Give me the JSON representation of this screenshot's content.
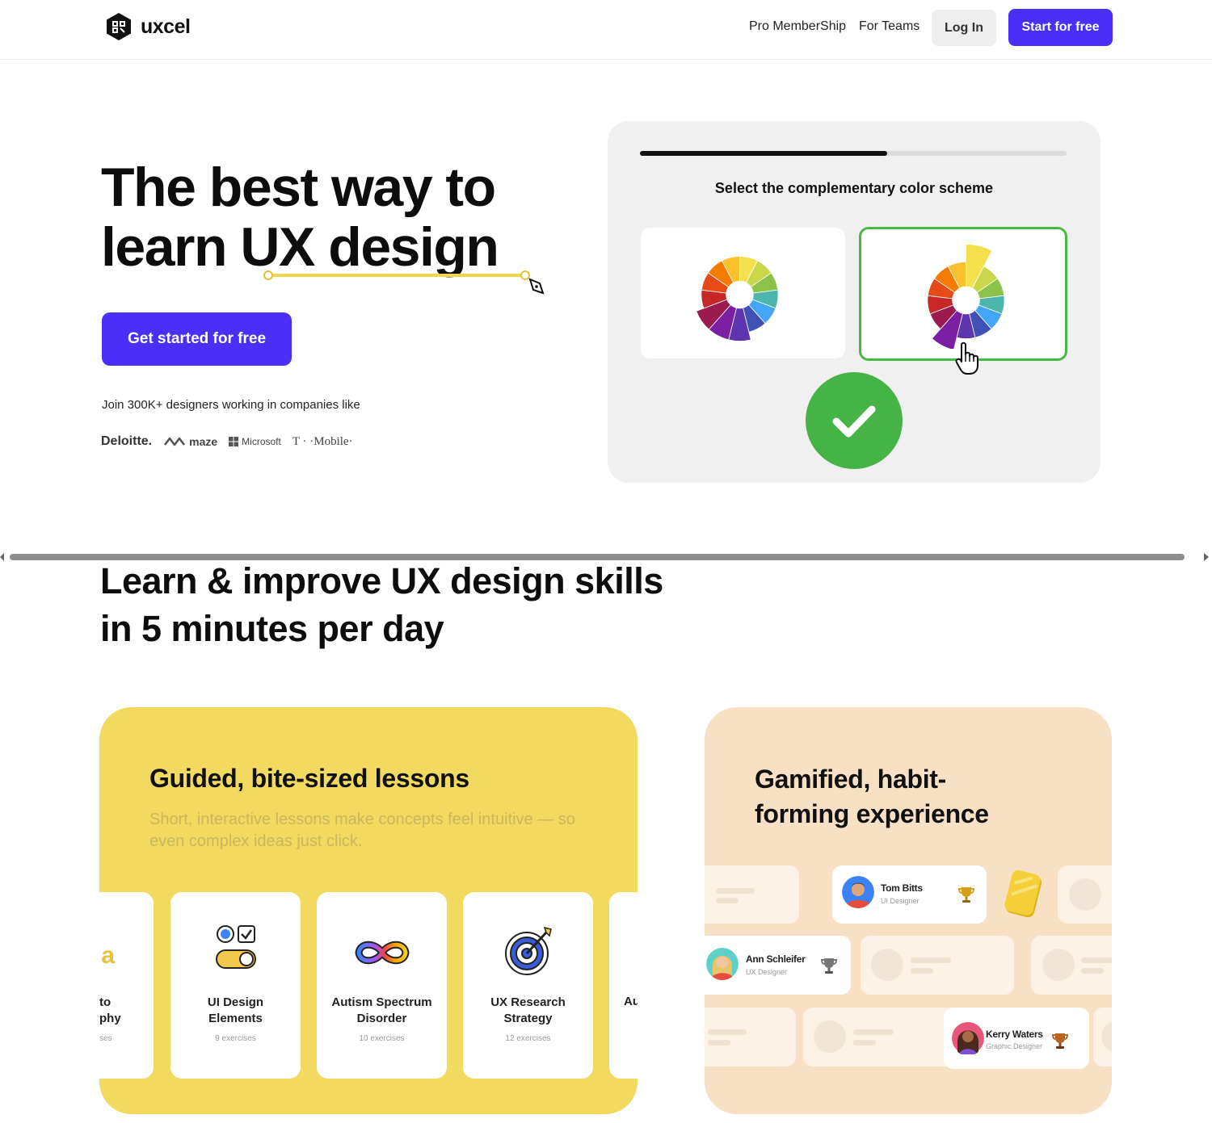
{
  "nav": {
    "brand": "uxcel",
    "links": [
      "Pro MemberShip",
      "For Teams"
    ],
    "login": "Log In",
    "cta": "Start for free"
  },
  "hero": {
    "title_line1": "The best way to",
    "title_line2": "learn UX design",
    "cta": "Get started for free",
    "join": "Join 300K+ designers working in companies like",
    "companies": [
      "Deloitte.",
      "maze",
      "Microsoft",
      "T · ·Mobile·"
    ]
  },
  "quiz": {
    "progress": 0.58,
    "question": "Select the complementary color scheme",
    "selected_option": 2
  },
  "section": {
    "title_line1": "Learn & improve UX design skills",
    "title_line2": "in 5 minutes per day"
  },
  "guided": {
    "title": "Guided, bite-sized lessons",
    "subtitle": "Short, interactive lessons make concepts feel intuitive — so even complex ideas just click.",
    "lessons": [
      {
        "name_line1": "to",
        "name_line2": "phy",
        "count": "ses",
        "partial": true
      },
      {
        "name_line1": "UI Design",
        "name_line2": "Elements",
        "count": "9 exercises",
        "icon": "toggle-checkbox-icon"
      },
      {
        "name_line1": "Autism Spectrum",
        "name_line2": "Disorder",
        "count": "10 exercises",
        "icon": "infinity-icon"
      },
      {
        "name_line1": "UX Research",
        "name_line2": "Strategy",
        "count": "12 exercises",
        "icon": "target-icon"
      },
      {
        "name_line1": "Au",
        "name_line2": "",
        "count": "",
        "partial": true
      }
    ]
  },
  "gamified": {
    "title_line1": "Gamified, habit-",
    "title_line2": "forming experience",
    "people": [
      {
        "name": "Tom Bitts",
        "role": "UI Designer",
        "trophy": "gold"
      },
      {
        "name": "Ann Schleifer",
        "role": "UX Designer",
        "trophy": "silver"
      },
      {
        "name": "Kerry Waters",
        "role": "Graphic Designer",
        "trophy": "bronze"
      }
    ]
  },
  "colors": {
    "brand": "#4b2ff6",
    "success": "#46b346",
    "yellow_card": "#f2d960",
    "peach_card": "#f7e0c4"
  }
}
